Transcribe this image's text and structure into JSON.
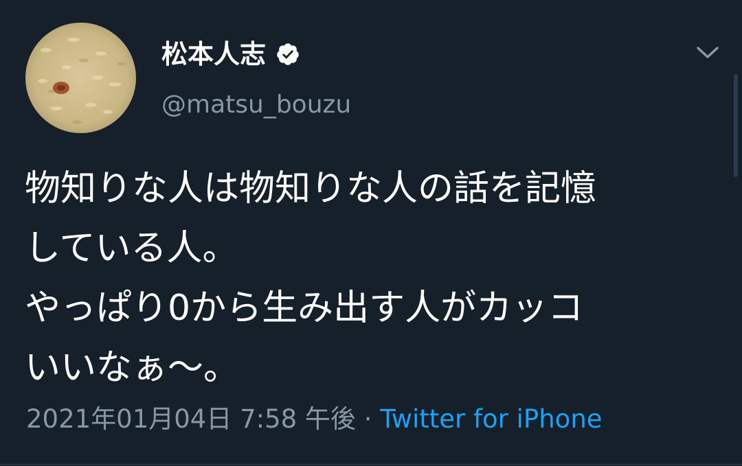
{
  "author": {
    "display_name": "松本人志",
    "handle": "@matsu_bouzu",
    "verified": true
  },
  "tweet": {
    "lines": [
      "物知りな人は物知りな人の話を記憶",
      "している人。",
      "やっぱり0から生み出す人がカッコ",
      "いいなぁ〜。"
    ]
  },
  "meta": {
    "timestamp": "2021年01月04日 7:58 午後",
    "separator": " · ",
    "source": "Twitter for iPhone"
  },
  "icons": {
    "verified": "verified-badge-icon",
    "menu": "chevron-down-icon"
  },
  "colors": {
    "background": "#15202b",
    "text_primary": "#ffffff",
    "text_secondary": "#8899a6",
    "link": "#1da1f2"
  }
}
